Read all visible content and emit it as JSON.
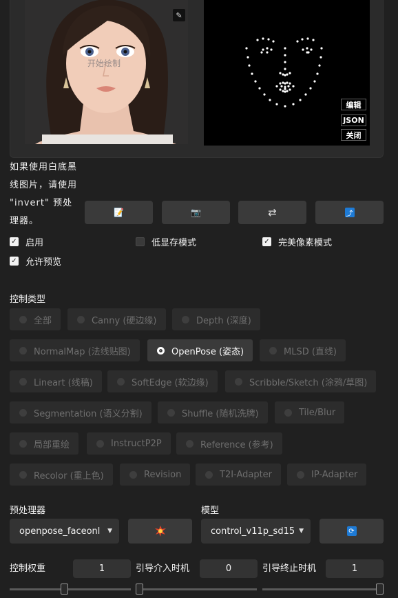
{
  "image_panel": {
    "start_draw_label": "开始绘制",
    "pose_buttons": {
      "edit": "编辑",
      "json": "JSON",
      "close": "关闭"
    }
  },
  "hint_text": "如果使用白底黑线图片，请使用 \"invert\" 预处理器。",
  "tool_buttons": [
    {
      "icon": "notepad-icon",
      "glyph": "📝"
    },
    {
      "icon": "camera-icon",
      "glyph": "📷"
    },
    {
      "icon": "swap-icon",
      "glyph": "⇄"
    },
    {
      "icon": "upload-icon",
      "glyph": "⤴"
    }
  ],
  "checkboxes": {
    "enable": {
      "label": "启用",
      "checked": true
    },
    "low_vram": {
      "label": "低显存模式",
      "checked": false
    },
    "pixel_perfect": {
      "label": "完美像素模式",
      "checked": true
    },
    "allow_preview": {
      "label": "允许预览",
      "checked": true
    }
  },
  "control_type": {
    "label": "控制类型",
    "options": [
      "全部",
      "Canny (硬边缘)",
      "Depth (深度)",
      "NormalMap (法线贴图)",
      "OpenPose (姿态)",
      "MLSD (直线)",
      "Lineart (线稿)",
      "SoftEdge (软边缘)",
      "Scribble/Sketch (涂鸦/草图)",
      "Segmentation (语义分割)",
      "Shuffle (随机洗牌)",
      "Tile/Blur",
      "局部重绘",
      "InstructP2P",
      "Reference (参考)",
      "Recolor (重上色)",
      "Revision",
      "T2I-Adapter",
      "IP-Adapter"
    ],
    "selected": "OpenPose (姿态)"
  },
  "preprocessor": {
    "label": "预处理器",
    "value": "openpose_faceonl"
  },
  "model": {
    "label": "模型",
    "value": "control_v11p_sd15"
  },
  "control_weight": {
    "label": "控制权重",
    "value": "1",
    "fraction": 0.45
  },
  "guidance_start": {
    "label": "引导介入时机",
    "value": "0",
    "fraction": 0.0
  },
  "guidance_end": {
    "label": "引导终止时机",
    "value": "1",
    "fraction": 1.0
  },
  "colors": {
    "accent_blue": "#1e7bd6",
    "bg": "#202020"
  }
}
